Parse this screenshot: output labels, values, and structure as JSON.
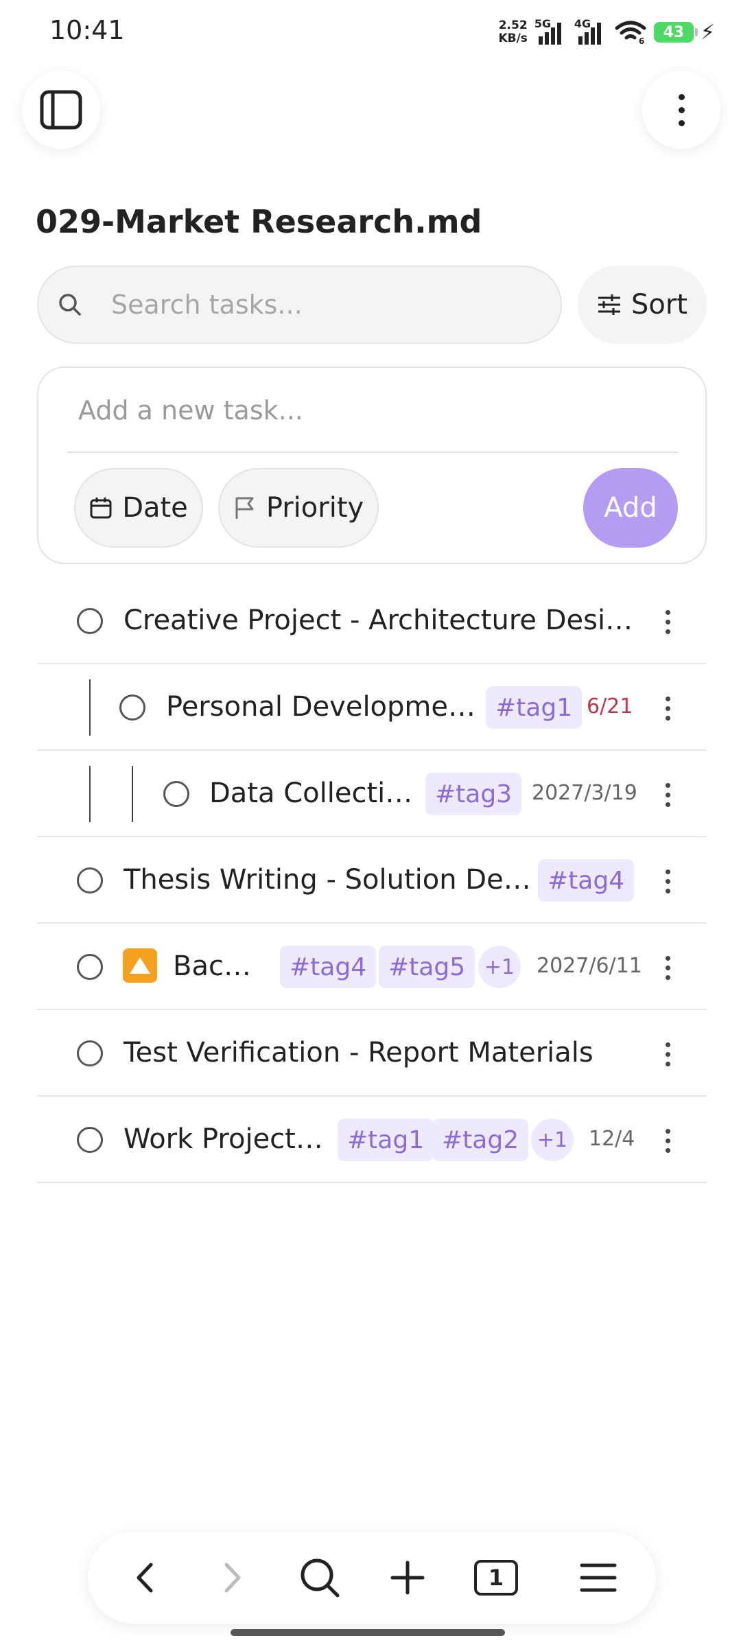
{
  "status": {
    "time": "10:41",
    "net_speed_value": "2.52",
    "net_speed_unit": "KB/s",
    "sim1_label": "5G",
    "sim2_label": "4G",
    "wifi_badge": "6",
    "battery": "43"
  },
  "header": {
    "title": "029-Market Research.md"
  },
  "search": {
    "placeholder": "Search tasks...",
    "sort_label": "Sort"
  },
  "new_task": {
    "placeholder": "Add a new task...",
    "date_label": "Date",
    "priority_label": "Priority",
    "add_label": "Add",
    "add_color": "#b49cf2"
  },
  "tasks": [
    {
      "title": "Creative Project - Architecture Desi…",
      "tags": [],
      "due": ""
    },
    {
      "title": "Personal Developme…",
      "tags": [
        "#tag1"
      ],
      "due": "6/21",
      "due_overdue": true
    },
    {
      "title": "Data Collecti…",
      "tags": [
        "#tag3"
      ],
      "due": "2027/3/19"
    },
    {
      "title": "Thesis Writing - Solution De…",
      "tags": [
        "#tag4"
      ],
      "due": ""
    },
    {
      "title": "Bac…",
      "priority_icon": "up-arrow-priority-icon",
      "tags": [
        "#tag4",
        "#tag5"
      ],
      "more_tags": "+1",
      "due": "2027/6/11"
    },
    {
      "title": "Test Verification - Report Materials",
      "tags": [],
      "due": ""
    },
    {
      "title": "Work Project…",
      "tags": [
        "#tag1",
        "#tag2"
      ],
      "more_tags": "+1",
      "due": "12/4"
    }
  ],
  "bottom_nav": {
    "tab_count": "1"
  },
  "colors": {
    "tag_bg": "#efe9fd",
    "tag_text": "#8c6ad8",
    "overdue": "#c0334a"
  }
}
